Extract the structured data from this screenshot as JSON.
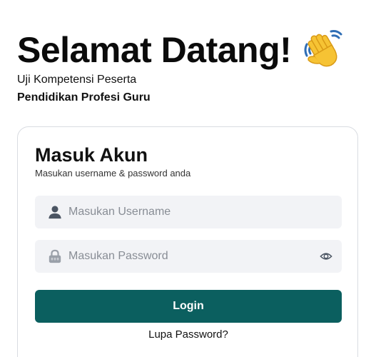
{
  "header": {
    "title": "Selamat Datang!",
    "wave_icon": "waving-hand-icon",
    "subtitle": "Uji Kompetensi Peserta",
    "subtitle_strong": "Pendidikan Profesi Guru"
  },
  "login_card": {
    "title": "Masuk Akun",
    "subtitle": "Masukan username & password anda",
    "username": {
      "icon": "user-icon",
      "placeholder": "Masukan Username",
      "value": ""
    },
    "password": {
      "icon": "lock-icon",
      "placeholder": "Masukan Password",
      "value": "",
      "toggle_icon": "eye-icon"
    },
    "login_label": "Login",
    "forgot_label": "Lupa Password?"
  },
  "colors": {
    "primary_button": "#0b5f5f",
    "field_background": "#f2f3f6",
    "card_border": "#d9dce1",
    "wave_yellow": "#f6c334",
    "wave_blue": "#2f6eb5"
  }
}
